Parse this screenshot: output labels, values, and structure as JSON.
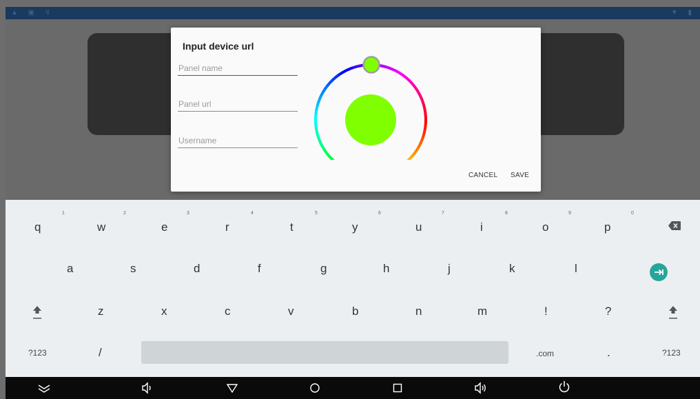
{
  "dialog": {
    "title": "Input device url",
    "fields": {
      "panel_name": {
        "placeholder": "Panel name",
        "value": ""
      },
      "panel_url": {
        "placeholder": "Panel url",
        "value": ""
      },
      "username": {
        "placeholder": "Username",
        "value": ""
      }
    },
    "selected_color": "#80ff00",
    "cancel_label": "CANCEL",
    "save_label": "SAVE"
  },
  "keyboard": {
    "row1": [
      {
        "label": "q",
        "hint": "1"
      },
      {
        "label": "w",
        "hint": "2"
      },
      {
        "label": "e",
        "hint": "3"
      },
      {
        "label": "r",
        "hint": "4"
      },
      {
        "label": "t",
        "hint": "5"
      },
      {
        "label": "y",
        "hint": "6"
      },
      {
        "label": "u",
        "hint": "7"
      },
      {
        "label": "i",
        "hint": "8"
      },
      {
        "label": "o",
        "hint": "9"
      },
      {
        "label": "p",
        "hint": "0"
      }
    ],
    "row2": [
      "a",
      "s",
      "d",
      "f",
      "g",
      "h",
      "j",
      "k",
      "l"
    ],
    "row3": [
      "z",
      "x",
      "c",
      "v",
      "b",
      "n",
      "m",
      "!",
      "?"
    ],
    "row4": {
      "symbols_left": "?123",
      "slash": "/",
      "dotcom": ".com",
      "period": ".",
      "symbols_right": "?123"
    },
    "accent_color": "#26a69a"
  },
  "nav": {
    "icons": [
      "hide-keyboard-icon",
      "volume-down-icon",
      "back-icon",
      "home-icon",
      "recents-icon",
      "volume-up-icon",
      "power-icon"
    ]
  }
}
